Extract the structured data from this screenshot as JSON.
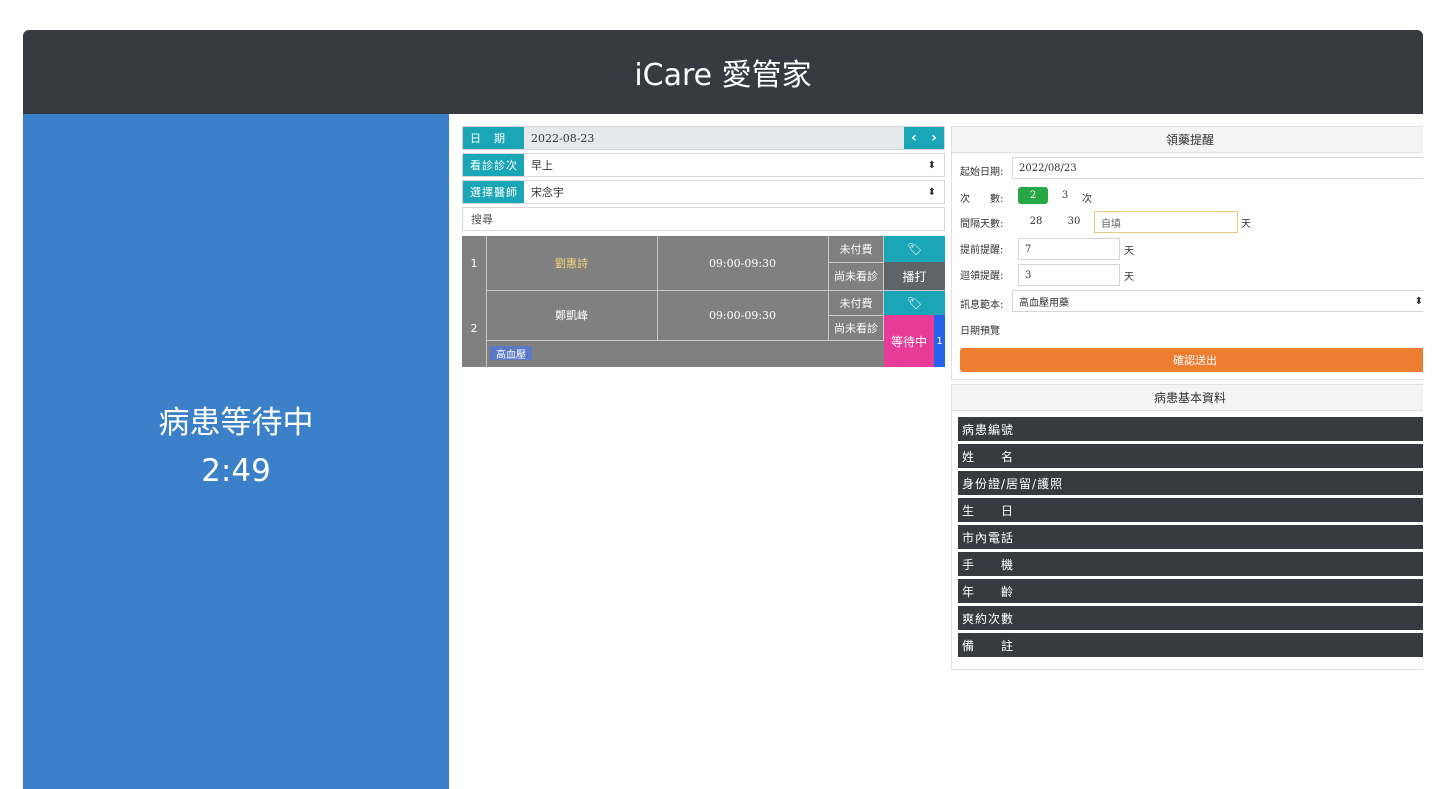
{
  "app": {
    "title": "iCare 愛管家"
  },
  "sidebar": {
    "status": "病患等待中",
    "timer": "2:49"
  },
  "filters": {
    "date_label": "日　期",
    "date_value": "2022-08-23",
    "prev_icon": "chevron-left-icon",
    "next_icon": "chevron-right-icon",
    "session_label": "看診診次",
    "session_value": "早上",
    "doctor_label": "選擇醫師",
    "doctor_value": "宋念宇",
    "search_placeholder": "搜尋"
  },
  "appointments": [
    {
      "no": "1",
      "name": "劉惠詩",
      "time": "09:00-09:30",
      "payment": "未付費",
      "visit": "尚未看診",
      "action": "播打",
      "tag": ""
    },
    {
      "no": "2",
      "name": "鄭凱峰",
      "time": "09:00-09:30",
      "payment": "未付費",
      "visit": "尚未看診",
      "action": "等待中",
      "action_count": "1",
      "tag": "高血壓"
    }
  ],
  "colors": {
    "accent": "#1aa6b7",
    "sidebar": "#3b80c8",
    "header": "#373a40",
    "submit": "#ee7d32",
    "waiting": "#e63b97",
    "patient_name_1": "#f2d37a"
  },
  "reminder": {
    "title": "領藥提醒",
    "start_date_label": "起始日期:",
    "start_date_value": "2022/08/23",
    "times_label": "次　　數:",
    "times_options": [
      "2",
      "3"
    ],
    "times_selected": "2",
    "times_unit": "次",
    "interval_label": "間隔天數:",
    "interval_options": [
      "28",
      "30"
    ],
    "interval_custom_placeholder": "自填",
    "interval_unit": "天",
    "advance_label": "提前提醒:",
    "advance_value": "7",
    "advance_unit": "天",
    "repeat_label": "迴領提醒:",
    "repeat_value": "3",
    "repeat_unit": "天",
    "template_label": "訊息範本:",
    "template_value": "高血壓用藥",
    "preview_label": "日期預覽",
    "submit_label": "確認送出"
  },
  "patient_info": {
    "title": "病患基本資料",
    "fields": [
      "病患編號",
      "姓　　名",
      "身份證/居留/護照",
      "生　　日",
      "市內電話",
      "手　　機",
      "年　　齡",
      "爽約次數",
      "備　　註"
    ]
  }
}
